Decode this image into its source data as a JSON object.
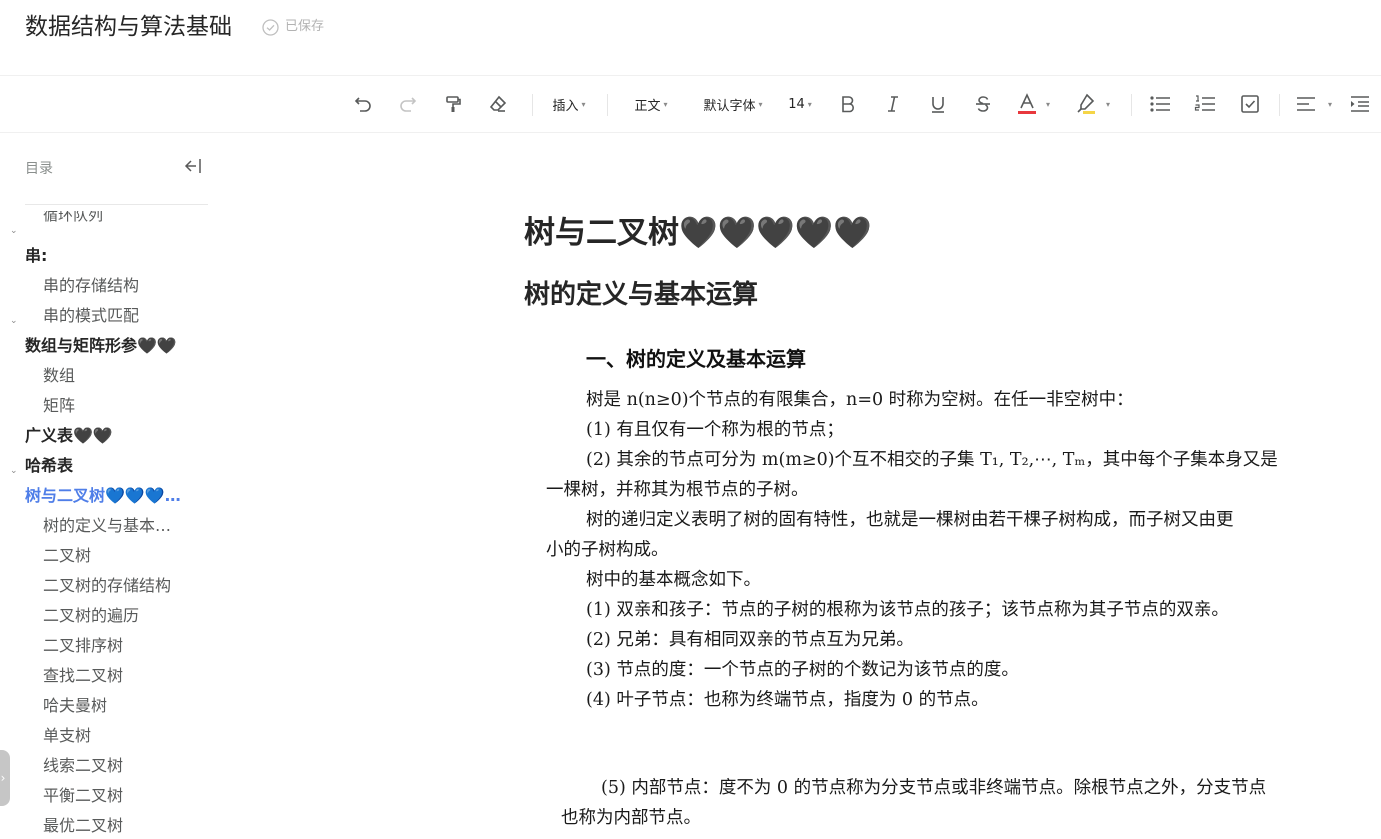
{
  "header": {
    "title": "数据结构与算法基础",
    "save_status": "已保存"
  },
  "toolbar": {
    "insert_label": "插入",
    "paragraph_label": "正文",
    "font_label": "默认字体",
    "size_label": "14",
    "caret": "▾"
  },
  "toc": {
    "title": "目录",
    "cut_item": "循环队列",
    "items": [
      {
        "label": "串:",
        "level": 1,
        "expanded": true
      },
      {
        "label": "串的存储结构",
        "level": 2
      },
      {
        "label": "串的模式匹配",
        "level": 2
      },
      {
        "label": "数组与矩阵形参🖤🖤",
        "level": 1,
        "expanded": true
      },
      {
        "label": "数组",
        "level": 2
      },
      {
        "label": "矩阵",
        "level": 2
      },
      {
        "label": "广义表🖤🖤",
        "level": 1
      },
      {
        "label": "哈希表",
        "level": 1
      },
      {
        "label": "树与二叉树💙💙💙…",
        "level": 1,
        "expanded": true,
        "active": true
      },
      {
        "label": "树的定义与基本…",
        "level": 2
      },
      {
        "label": "二叉树",
        "level": 2
      },
      {
        "label": "二叉树的存储结构",
        "level": 2
      },
      {
        "label": "二叉树的遍历",
        "level": 2
      },
      {
        "label": "二叉排序树",
        "level": 2
      },
      {
        "label": "查找二叉树",
        "level": 2
      },
      {
        "label": "哈夫曼树",
        "level": 2
      },
      {
        "label": "单支树",
        "level": 2
      },
      {
        "label": "线索二叉树",
        "level": 2
      },
      {
        "label": "平衡二叉树",
        "level": 2
      },
      {
        "label": "最优二叉树",
        "level": 2
      }
    ],
    "arrow": "⌄",
    "side_tab_arrow": "›"
  },
  "content": {
    "h1": "树与二叉树🖤🖤🖤🖤🖤",
    "h2": "树的定义与基本运算",
    "image": {
      "heading": "一、树的定义及基本运算",
      "lines": [
        "树是 n(n≥0)个节点的有限集合，n=0 时称为空树。在任一非空树中：",
        "(1)  有且仅有一个称为根的节点；",
        "(2)  其余的节点可分为 m(m≥0)个互不相交的子集 T₁, T₂,⋯, Tₘ，其中每个子集本身又是",
        "一棵树，并称其为根节点的子树。",
        "树的递归定义表明了树的固有特性，也就是一棵树由若干棵子树构成，而子树又由更",
        "小的子树构成。",
        "树中的基本概念如下。",
        "(1)  双亲和孩子：节点的子树的根称为该节点的孩子；该节点称为其子节点的双亲。",
        "(2)  兄弟：具有相同双亲的节点互为兄弟。",
        "(3)  节点的度：一个节点的子树的个数记为该节点的度。",
        "(4)  叶子节点：也称为终端节点，指度为 0 的节点。",
        "(5)  内部节点：度不为 0 的节点称为分支节点或非终端节点。除根节点之外，分支节点",
        "也称为内部节点。"
      ]
    }
  },
  "colors": {
    "accent": "#4f7ee8",
    "font_color_underline": "#e8383d",
    "highlight_underline": "#f5d547"
  }
}
